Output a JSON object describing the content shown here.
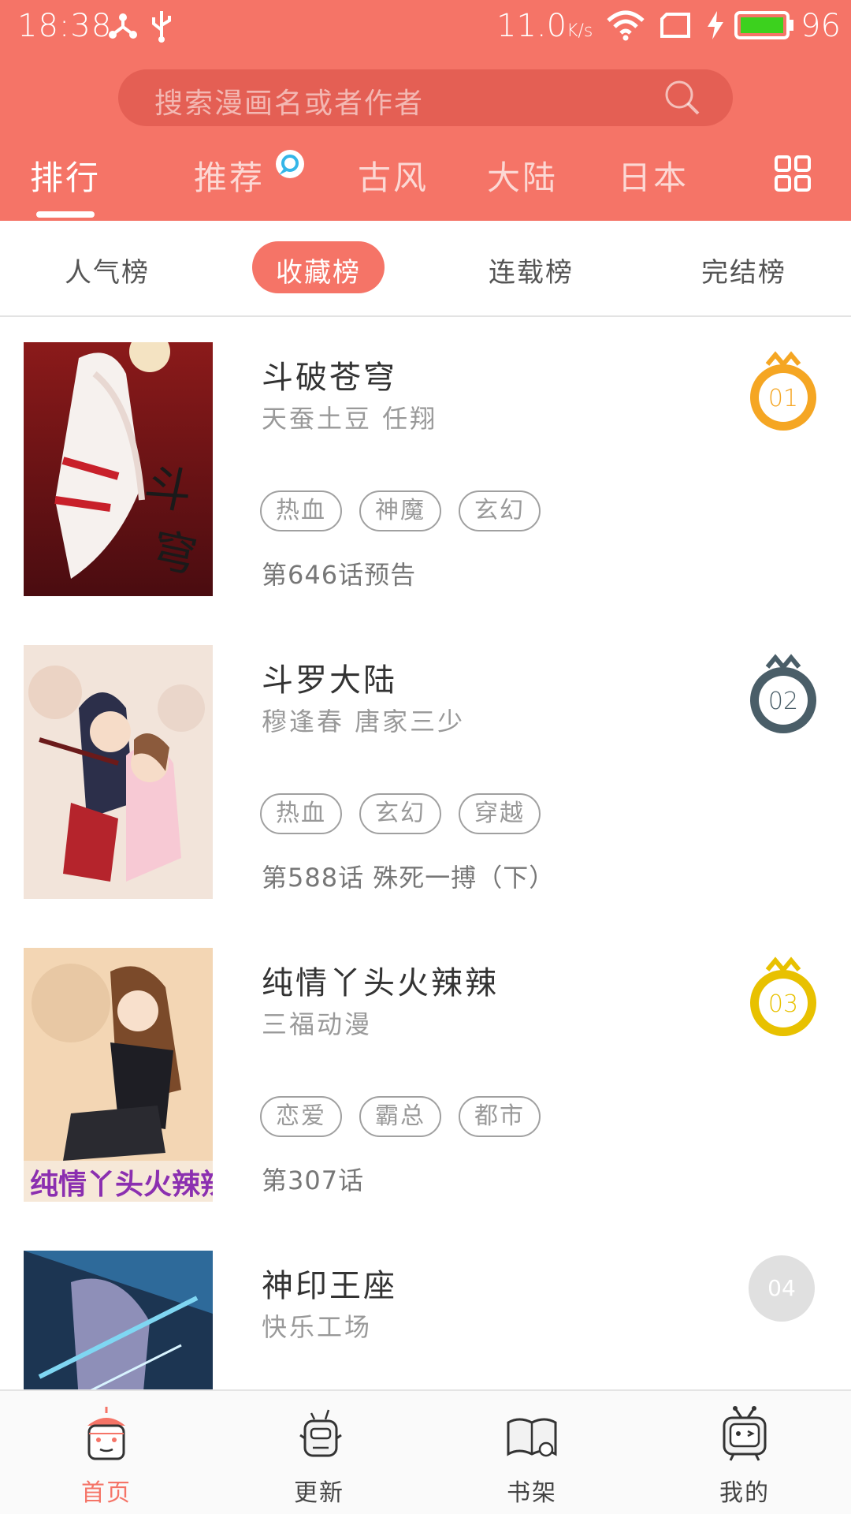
{
  "status_bar": {
    "time": "18:38",
    "speed": "11.0",
    "speed_unit": "K/s",
    "battery": "96"
  },
  "search": {
    "placeholder": "搜索漫画名或者作者"
  },
  "tabs": [
    {
      "label": "排行",
      "active": true
    },
    {
      "label": "推荐",
      "active": false
    },
    {
      "label": "古风",
      "active": false
    },
    {
      "label": "大陆",
      "active": false
    },
    {
      "label": "日本",
      "active": false
    }
  ],
  "subtabs": [
    {
      "label": "人气榜",
      "active": false
    },
    {
      "label": "收藏榜",
      "active": true
    },
    {
      "label": "连载榜",
      "active": false
    },
    {
      "label": "完结榜",
      "active": false
    }
  ],
  "comics": [
    {
      "title": "斗破苍穹",
      "authors": "天蚕土豆  任翔",
      "tags": [
        "热血",
        "神魔",
        "玄幻"
      ],
      "chapter": "第646话预告",
      "rank": "01",
      "rank_color": "#F5A623"
    },
    {
      "title": "斗罗大陆",
      "authors": "穆逢春  唐家三少",
      "tags": [
        "热血",
        "玄幻",
        "穿越"
      ],
      "chapter": "第588话  殊死一搏（下）",
      "rank": "02",
      "rank_color": "#4A5E68"
    },
    {
      "title": "纯情丫头火辣辣",
      "authors": "三福动漫",
      "tags": [
        "恋爱",
        "霸总",
        "都市"
      ],
      "chapter": "第307话",
      "rank": "03",
      "rank_color": "#E8C100"
    },
    {
      "title": "神印王座",
      "authors": "快乐工场",
      "tags": [],
      "chapter": "",
      "rank": "04",
      "rank_color": "#E0E0E0"
    }
  ],
  "bottom_nav": [
    {
      "label": "首页",
      "icon": "home-lantern-icon",
      "active": true
    },
    {
      "label": "更新",
      "icon": "update-robot-icon",
      "active": false
    },
    {
      "label": "书架",
      "icon": "bookshelf-book-icon",
      "active": false
    },
    {
      "label": "我的",
      "icon": "profile-tv-icon",
      "active": false
    }
  ],
  "colors": {
    "accent": "#F57467",
    "rank1": "#F5A623",
    "rank2": "#4A5E68",
    "rank3": "#E8C100"
  }
}
